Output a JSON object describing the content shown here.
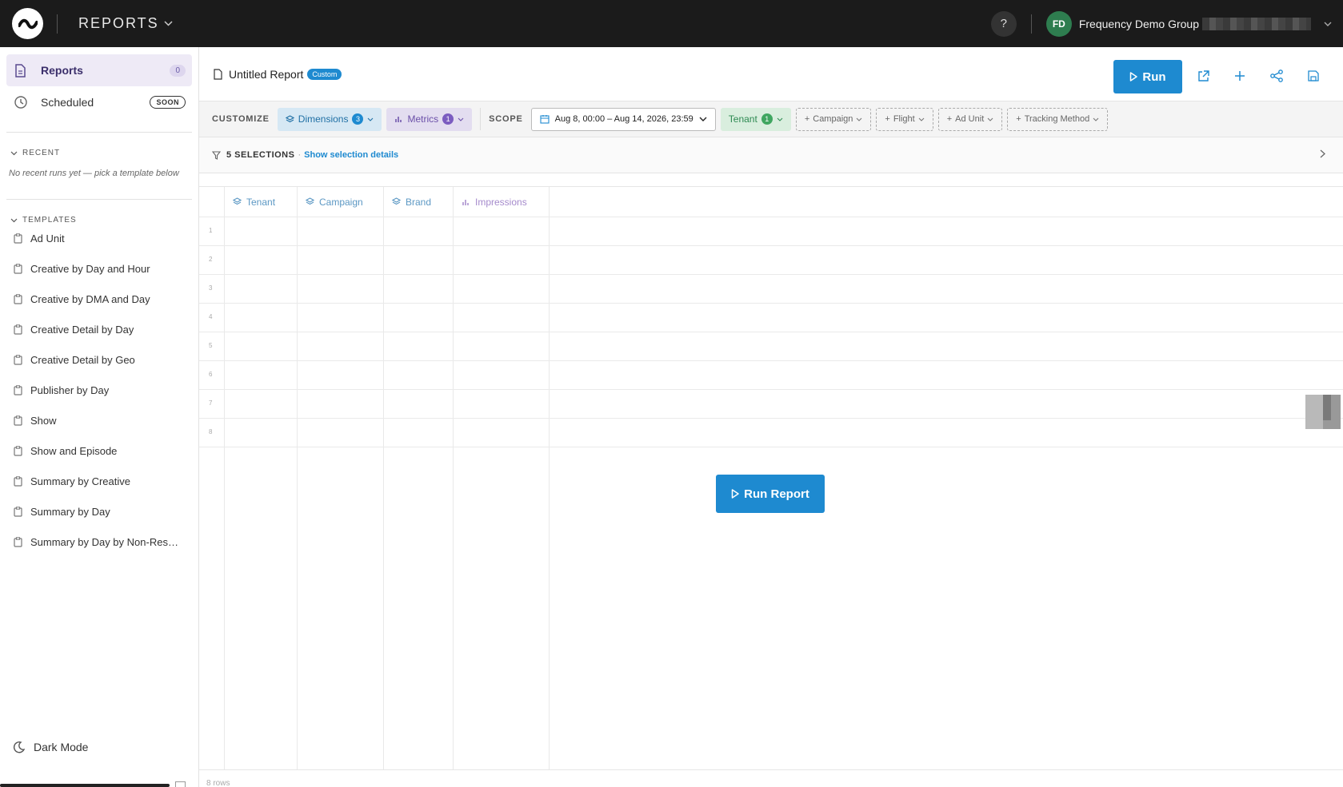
{
  "topbar": {
    "app_name": "REPORTS",
    "help_label": "?",
    "avatar_initials": "FD",
    "org_name": "Frequency Demo Group"
  },
  "sidebar": {
    "nav": [
      {
        "label": "Reports",
        "badge": "0",
        "icon": "document-icon"
      },
      {
        "label": "Scheduled",
        "badge": "SOON",
        "icon": "clock-icon"
      }
    ],
    "recent_heading": "RECENT",
    "recent_empty": "No recent runs yet — pick a template below",
    "templates_heading": "TEMPLATES",
    "templates": [
      "Ad Unit",
      "Creative by Day and Hour",
      "Creative by DMA and Day",
      "Creative Detail by Day",
      "Creative Detail by Geo",
      "Publisher by Day",
      "Show",
      "Show and Episode",
      "Summary by Creative",
      "Summary by Day",
      "Summary by Day by Non-Resp…"
    ],
    "dark_mode_label": "Dark Mode"
  },
  "header": {
    "report_title": "Untitled Report",
    "custom_badge": "Custom",
    "run_label": "Run"
  },
  "customize": {
    "label": "CUSTOMIZE",
    "dimensions_label": "Dimensions",
    "dimensions_count": "3",
    "metrics_label": "Metrics",
    "metrics_count": "1",
    "scope_label": "SCOPE",
    "date_range": "Aug 8, 00:00 – Aug 14, 2026, 23:59",
    "tenant_label": "Tenant",
    "tenant_count": "1",
    "add_filters": [
      "Campaign",
      "Flight",
      "Ad Unit",
      "Tracking Method"
    ]
  },
  "selections": {
    "count_text": "5 SELECTIONS",
    "separator": "·",
    "details_link": "Show selection details"
  },
  "grid": {
    "columns": [
      {
        "label": "Tenant",
        "kind": "dimension"
      },
      {
        "label": "Campaign",
        "kind": "dimension"
      },
      {
        "label": "Brand",
        "kind": "dimension"
      },
      {
        "label": "Impressions",
        "kind": "metric"
      }
    ],
    "row_numbers": [
      "1",
      "2",
      "3",
      "4",
      "5",
      "6",
      "7",
      "8"
    ],
    "run_report_label": "Run Report",
    "row_count": "8 rows"
  },
  "colors": {
    "accent": "#1e8ad0",
    "dimension": "#5c98c4",
    "metric": "#a58acc",
    "tenant": "#2e8a52"
  }
}
